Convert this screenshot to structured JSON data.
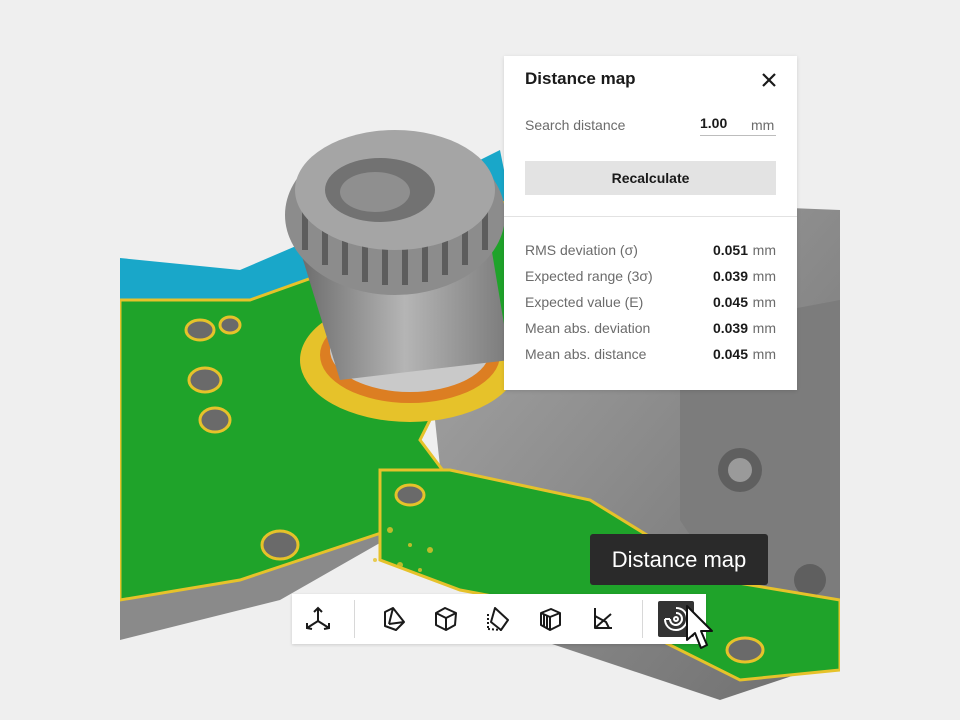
{
  "panel": {
    "title": "Distance map",
    "search_label": "Search distance",
    "search_value": "1.00",
    "search_unit": "mm",
    "recalculate_label": "Recalculate",
    "stats": [
      {
        "label": "RMS deviation (σ)",
        "value": "0.051",
        "unit": "mm"
      },
      {
        "label": "Expected range (3σ)",
        "value": "0.039",
        "unit": "mm"
      },
      {
        "label": "Expected value (E)",
        "value": "0.045",
        "unit": "mm"
      },
      {
        "label": "Mean abs. deviation",
        "value": "0.039",
        "unit": "mm"
      },
      {
        "label": "Mean abs. distance",
        "value": "0.045",
        "unit": "mm"
      }
    ]
  },
  "tooltip": {
    "text": "Distance map"
  },
  "toolbar": {
    "tools": [
      {
        "icon": "axes-icon"
      },
      {
        "icon": "slice-plane-icon"
      },
      {
        "icon": "box-cut-icon"
      },
      {
        "icon": "plane-section-icon"
      },
      {
        "icon": "cube-slices-icon"
      },
      {
        "icon": "angle-measure-icon"
      },
      {
        "icon": "distance-map-icon",
        "active": true
      }
    ]
  },
  "colors": {
    "model_gray": "#8f8f8f",
    "deviation_green": "#1fa32a",
    "deviation_yellow": "#e6c22a",
    "deviation_red": "#d23a1a",
    "deviation_cyan": "#19a7c9",
    "tooltip_bg": "#2a2a2a"
  }
}
